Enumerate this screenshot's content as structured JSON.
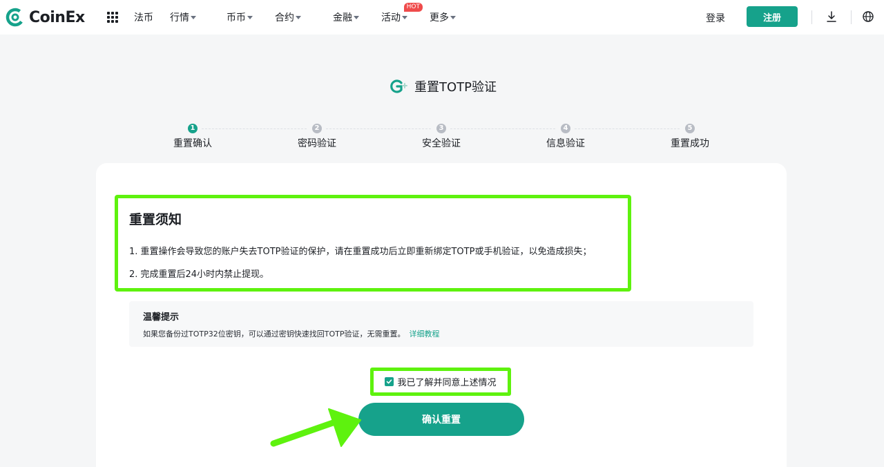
{
  "header": {
    "brand": "CoinEx",
    "nav": [
      {
        "label": "法币",
        "caret": false
      },
      {
        "label": "行情",
        "caret": true
      },
      {
        "label": "币币",
        "caret": true
      },
      {
        "label": "合约",
        "caret": true
      },
      {
        "label": "金融",
        "caret": true
      },
      {
        "label": "活动",
        "caret": true,
        "badge": "HOT"
      },
      {
        "label": "更多",
        "caret": true
      }
    ],
    "login": "登录",
    "signup": "注册"
  },
  "page": {
    "title": "重置TOTP验证"
  },
  "steps": [
    {
      "num": "1",
      "label": "重置确认",
      "active": true
    },
    {
      "num": "2",
      "label": "密码验证",
      "active": false
    },
    {
      "num": "3",
      "label": "安全验证",
      "active": false
    },
    {
      "num": "4",
      "label": "信息验证",
      "active": false
    },
    {
      "num": "5",
      "label": "重置成功",
      "active": false
    }
  ],
  "notice": {
    "title": "重置须知",
    "line1": "1. 重置操作会导致您的账户失去TOTP验证的保护，请在重置成功后立即重新绑定TOTP或手机验证，以免造成损失；",
    "line2": "2. 完成重置后24小时内禁止提现。"
  },
  "tip": {
    "title": "温馨提示",
    "text": "如果您备份过TOTP32位密钥，可以通过密钥快速找回TOTP验证，无需重置。",
    "link": "详细教程"
  },
  "agree": {
    "label": "我已了解并同意上述情况",
    "checked": true
  },
  "confirm_button": "确认重置",
  "colors": {
    "accent": "#16a28b",
    "highlight": "#5ef20e",
    "hot": "#ef4b4b"
  }
}
